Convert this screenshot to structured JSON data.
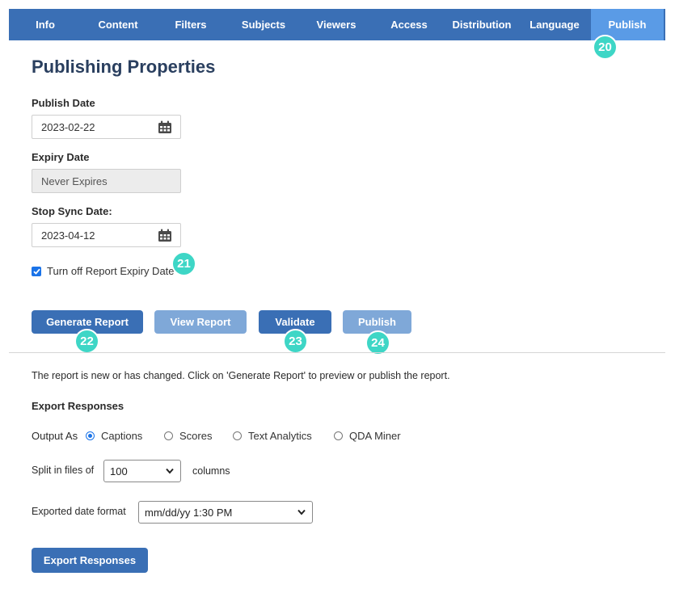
{
  "tabs": [
    {
      "label": "Info",
      "active": false
    },
    {
      "label": "Content",
      "active": false
    },
    {
      "label": "Filters",
      "active": false
    },
    {
      "label": "Subjects",
      "active": false
    },
    {
      "label": "Viewers",
      "active": false
    },
    {
      "label": "Access",
      "active": false
    },
    {
      "label": "Distribution",
      "active": false
    },
    {
      "label": "Language",
      "active": false
    },
    {
      "label": "Publish",
      "active": true
    }
  ],
  "badges": {
    "b20": "20",
    "b21": "21",
    "b22": "22",
    "b23": "23",
    "b24": "24"
  },
  "page_title": "Publishing Properties",
  "publish_date": {
    "label": "Publish Date",
    "value": "2023-02-22"
  },
  "expiry_date": {
    "label": "Expiry Date",
    "value": "Never Expires"
  },
  "stop_sync_date": {
    "label": "Stop Sync Date:",
    "value": "2023-04-12"
  },
  "turn_off_expiry": {
    "label": "Turn off Report Expiry Date",
    "checked": true
  },
  "buttons": {
    "generate": "Generate Report",
    "view": "View Report",
    "validate": "Validate",
    "publish": "Publish"
  },
  "status_message": "The report is new or has changed. Click on 'Generate Report' to preview or publish the report.",
  "export": {
    "heading": "Export Responses",
    "output_as_label": "Output As",
    "output_options": [
      "Captions",
      "Scores",
      "Text Analytics",
      "QDA Miner"
    ],
    "output_selected": "Captions",
    "split_label": "Split in files of",
    "split_value": "100",
    "columns_label": "columns",
    "date_format_label": "Exported date format",
    "date_format_value": "mm/dd/yy 1:30 PM",
    "button": "Export Responses"
  },
  "colors": {
    "accent": "#3a6fb5",
    "active_tab": "#5a9be6",
    "badge": "#3ed6c6",
    "muted_button": "#7fa8d8"
  },
  "icons": {
    "date_picker": "calendar-icon",
    "select": "chevron-down-icon",
    "checkbox": "check-icon"
  }
}
